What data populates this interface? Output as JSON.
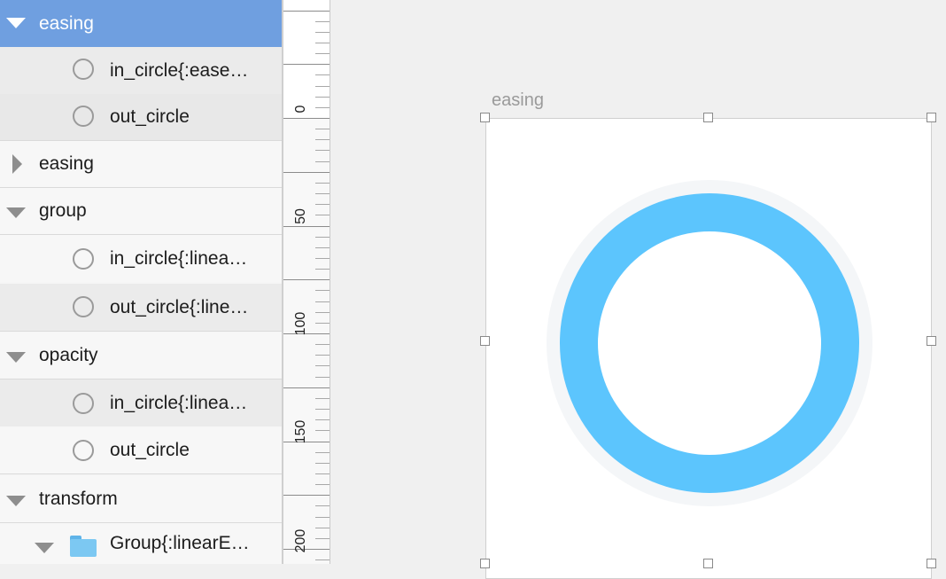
{
  "colors": {
    "selection": "#6f9fe0",
    "ring_fill": "#5cc5fd",
    "folder": "#7cc8f2"
  },
  "layers": [
    {
      "label": "easing",
      "disclosure": "expanded",
      "icon": "none",
      "selected": true
    },
    {
      "label": "in_circle{:ease…",
      "icon": "circle-icon"
    },
    {
      "label": "out_circle",
      "icon": "circle-icon"
    },
    {
      "label": "easing",
      "disclosure": "collapsed",
      "icon": "none"
    },
    {
      "label": "group",
      "disclosure": "expanded",
      "icon": "none"
    },
    {
      "label": "in_circle{:linea…",
      "icon": "circle-icon"
    },
    {
      "label": "out_circle{:line…",
      "icon": "circle-icon"
    },
    {
      "label": "opacity",
      "disclosure": "expanded",
      "icon": "none"
    },
    {
      "label": "in_circle{:linea…",
      "icon": "circle-icon"
    },
    {
      "label": "out_circle",
      "icon": "circle-icon"
    },
    {
      "label": "transform",
      "disclosure": "expanded",
      "icon": "none"
    },
    {
      "label": "Group{:linearE…",
      "disclosure": "expanded",
      "icon": "folder-icon"
    }
  ],
  "ruler": {
    "labels": [
      "0",
      "50",
      "100",
      "150",
      "200"
    ]
  },
  "canvas": {
    "artboard_title": "easing"
  }
}
